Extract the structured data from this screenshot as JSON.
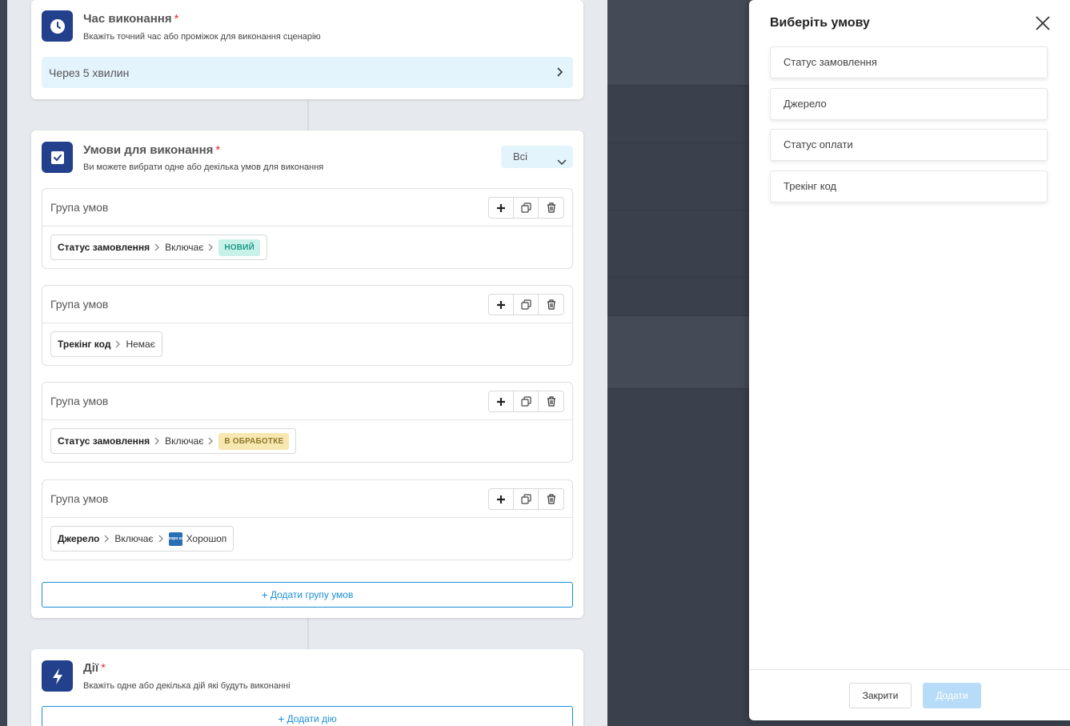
{
  "time_card": {
    "title": "Час виконання",
    "required_mark": "*",
    "subtitle": "Вкажіть точний час або проміжок для виконання сценарію",
    "value": "Через 5 хвилин"
  },
  "conditions_card": {
    "title": "Умови для виконання",
    "required_mark": "*",
    "subtitle": "Ви можете вибрати одне або декілька умов для виконання",
    "match_mode": "Всі",
    "groups": [
      {
        "label": "Група умов",
        "field": "Статус замовлення",
        "operator": "Включає",
        "value": "НОВИЙ"
      },
      {
        "label": "Група умов",
        "field": "Трекінг код",
        "value": "Немає"
      },
      {
        "label": "Група умов",
        "field": "Статус замовлення",
        "operator": "Включає",
        "value": "В ОБРАБОТКЕ"
      },
      {
        "label": "Група умов",
        "field": "Джерело",
        "operator": "Включає",
        "value": "Хорошоп",
        "logo_text": "хоро шоп"
      }
    ],
    "add_group_label": "Додати групу умов"
  },
  "actions_card": {
    "title": "Дії",
    "required_mark": "*",
    "subtitle": "Вкажіть одне або декілька дій які будуть виконанні",
    "add_action_label": "Додати дію"
  },
  "panel": {
    "title": "Виберіть умову",
    "options": [
      "Статус замовлення",
      "Джерело",
      "Статус оплати",
      "Трекінг код"
    ],
    "close_label": "Закрити",
    "add_label": "Додати"
  },
  "colors": {
    "icon_bg": "#22408b",
    "accent": "#1a8fd6",
    "required": "#e0323c",
    "badge_new_bg": "#c8f1ea",
    "badge_processing_bg": "#f7e7b0",
    "add_disabled": "#b7dcf8"
  },
  "icons": [
    "clock-icon",
    "checkbox-icon",
    "lightning-icon",
    "chevron-right-icon",
    "chevron-down-icon",
    "plus-icon",
    "copy-icon",
    "trash-icon",
    "close-icon"
  ]
}
